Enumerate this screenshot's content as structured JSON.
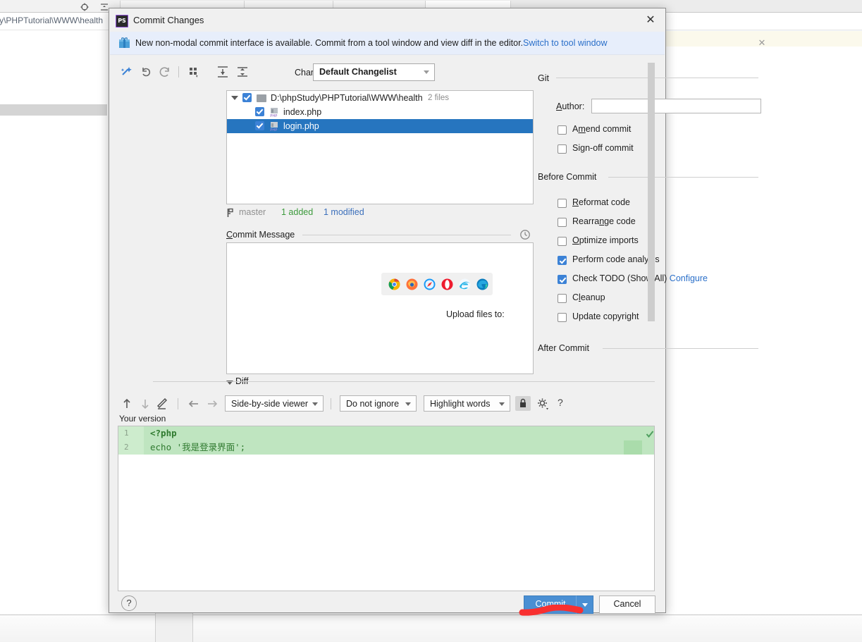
{
  "background": {
    "breadcrumb_text": "y\\PHPTutorial\\WWW\\health",
    "target_icon": "locate-target-icon",
    "collapse_icon": "collapse-all-icon"
  },
  "dialog": {
    "title": "Commit Changes",
    "app_icon": "phpstorm-icon",
    "close_icon": "close-icon"
  },
  "notification": {
    "icon": "gift-icon",
    "text": "New non-modal commit interface is available. Commit from a tool window and view diff in the editor.",
    "link": "Switch to tool window",
    "close_icon": "close-icon"
  },
  "toolbar": {
    "buttons": [
      {
        "name": "refresh-changes-icon",
        "glyph": "magic-wand-icon"
      },
      {
        "name": "revert-icon",
        "glyph": "undo-arrow-icon"
      },
      {
        "name": "refresh-icon",
        "glyph": "refresh-icon"
      },
      {
        "name": "group-by-icon",
        "glyph": "group-by-icon"
      },
      {
        "name": "expand-all-icon",
        "glyph": "expand-all-icon"
      },
      {
        "name": "collapse-all-icon",
        "glyph": "collapse-all-icon"
      }
    ],
    "changelist_label": "Changelist:",
    "changelist_value": "Default Changelist"
  },
  "file_tree": {
    "root": {
      "path": "D:\\phpStudy\\PHPTutorial\\WWW\\health",
      "count_label": "2 files",
      "checked": true,
      "expanded": true
    },
    "files": [
      {
        "name": "index.php",
        "checked": true,
        "selected": false,
        "icon": "php-file-icon"
      },
      {
        "name": "login.php",
        "checked": true,
        "selected": true,
        "icon": "php-file-icon"
      }
    ]
  },
  "status_bar": {
    "branch_icon": "git-branch-icon",
    "branch": "master",
    "added": "1 added",
    "modified": "1 modified"
  },
  "commit_message": {
    "legend": "Commit Message",
    "history_icon": "clock-history-icon",
    "value": "",
    "browser_icons": [
      {
        "name": "chrome-icon",
        "color": "#4285f4"
      },
      {
        "name": "firefox-icon",
        "color": "#ff7139"
      },
      {
        "name": "safari-icon",
        "color": "#1b9af7"
      },
      {
        "name": "opera-icon",
        "color": "#ee1b2e"
      },
      {
        "name": "internet-explorer-icon",
        "color": "#26b4e8"
      },
      {
        "name": "edge-icon",
        "color": "#0c7dbe"
      }
    ]
  },
  "options": {
    "git_group": "Git",
    "author_label": "Author:",
    "author_value": "",
    "git_checks": [
      {
        "label": "Amend commit",
        "checked": false,
        "name": "amend-commit-checkbox"
      },
      {
        "label": "Sign-off commit",
        "checked": false,
        "name": "sign-off-commit-checkbox"
      }
    ],
    "before_group": "Before Commit",
    "before_checks": [
      {
        "label": "Reformat code",
        "checked": false,
        "name": "reformat-code-checkbox",
        "extra": ""
      },
      {
        "label": "Rearrange code",
        "checked": false,
        "name": "rearrange-code-checkbox",
        "extra": ""
      },
      {
        "label": "Optimize imports",
        "checked": false,
        "name": "optimize-imports-checkbox",
        "extra": ""
      },
      {
        "label": "Perform code analysis",
        "checked": true,
        "name": "perform-code-analysis-checkbox",
        "extra": ""
      },
      {
        "label": "Check TODO (Show All)",
        "checked": true,
        "name": "check-todo-checkbox",
        "extra": "Configure"
      },
      {
        "label": "Cleanup",
        "checked": false,
        "name": "cleanup-checkbox",
        "extra": ""
      },
      {
        "label": "Update copyright",
        "checked": false,
        "name": "update-copyright-checkbox",
        "extra": ""
      }
    ],
    "after_group": "After Commit",
    "upload_label": "Upload files to:"
  },
  "diff": {
    "section_title": "Diff",
    "toolbar": {
      "prev_icon": "arrow-up-icon",
      "next_icon": "arrow-down-icon",
      "edit_icon": "pencil-icon",
      "accept_left_icon": "arrow-left-icon",
      "accept_right_icon": "arrow-right-icon",
      "viewer_mode": "Side-by-side viewer",
      "whitespace_mode": "Do not ignore",
      "highlight_mode": "Highlight words",
      "lock_icon": "lock-icon",
      "settings_icon": "gear-icon",
      "help_icon": "question-mark-icon"
    },
    "version_label": "Your version",
    "lines": [
      {
        "no": "1",
        "code": "<?php",
        "kind": "added"
      },
      {
        "no": "2",
        "code": "echo '我是登录界面';",
        "kind": "added"
      }
    ]
  },
  "footer": {
    "help_label": "?",
    "commit_label": "Commit",
    "commit_dropdown_icon": "chevron-down-icon",
    "cancel_label": "Cancel"
  },
  "colors": {
    "accent": "#4a8fd3",
    "selection": "#2675bf",
    "added_green": "#bfe5c0",
    "link": "#2a6fc9",
    "annotation_red": "#f83030"
  }
}
